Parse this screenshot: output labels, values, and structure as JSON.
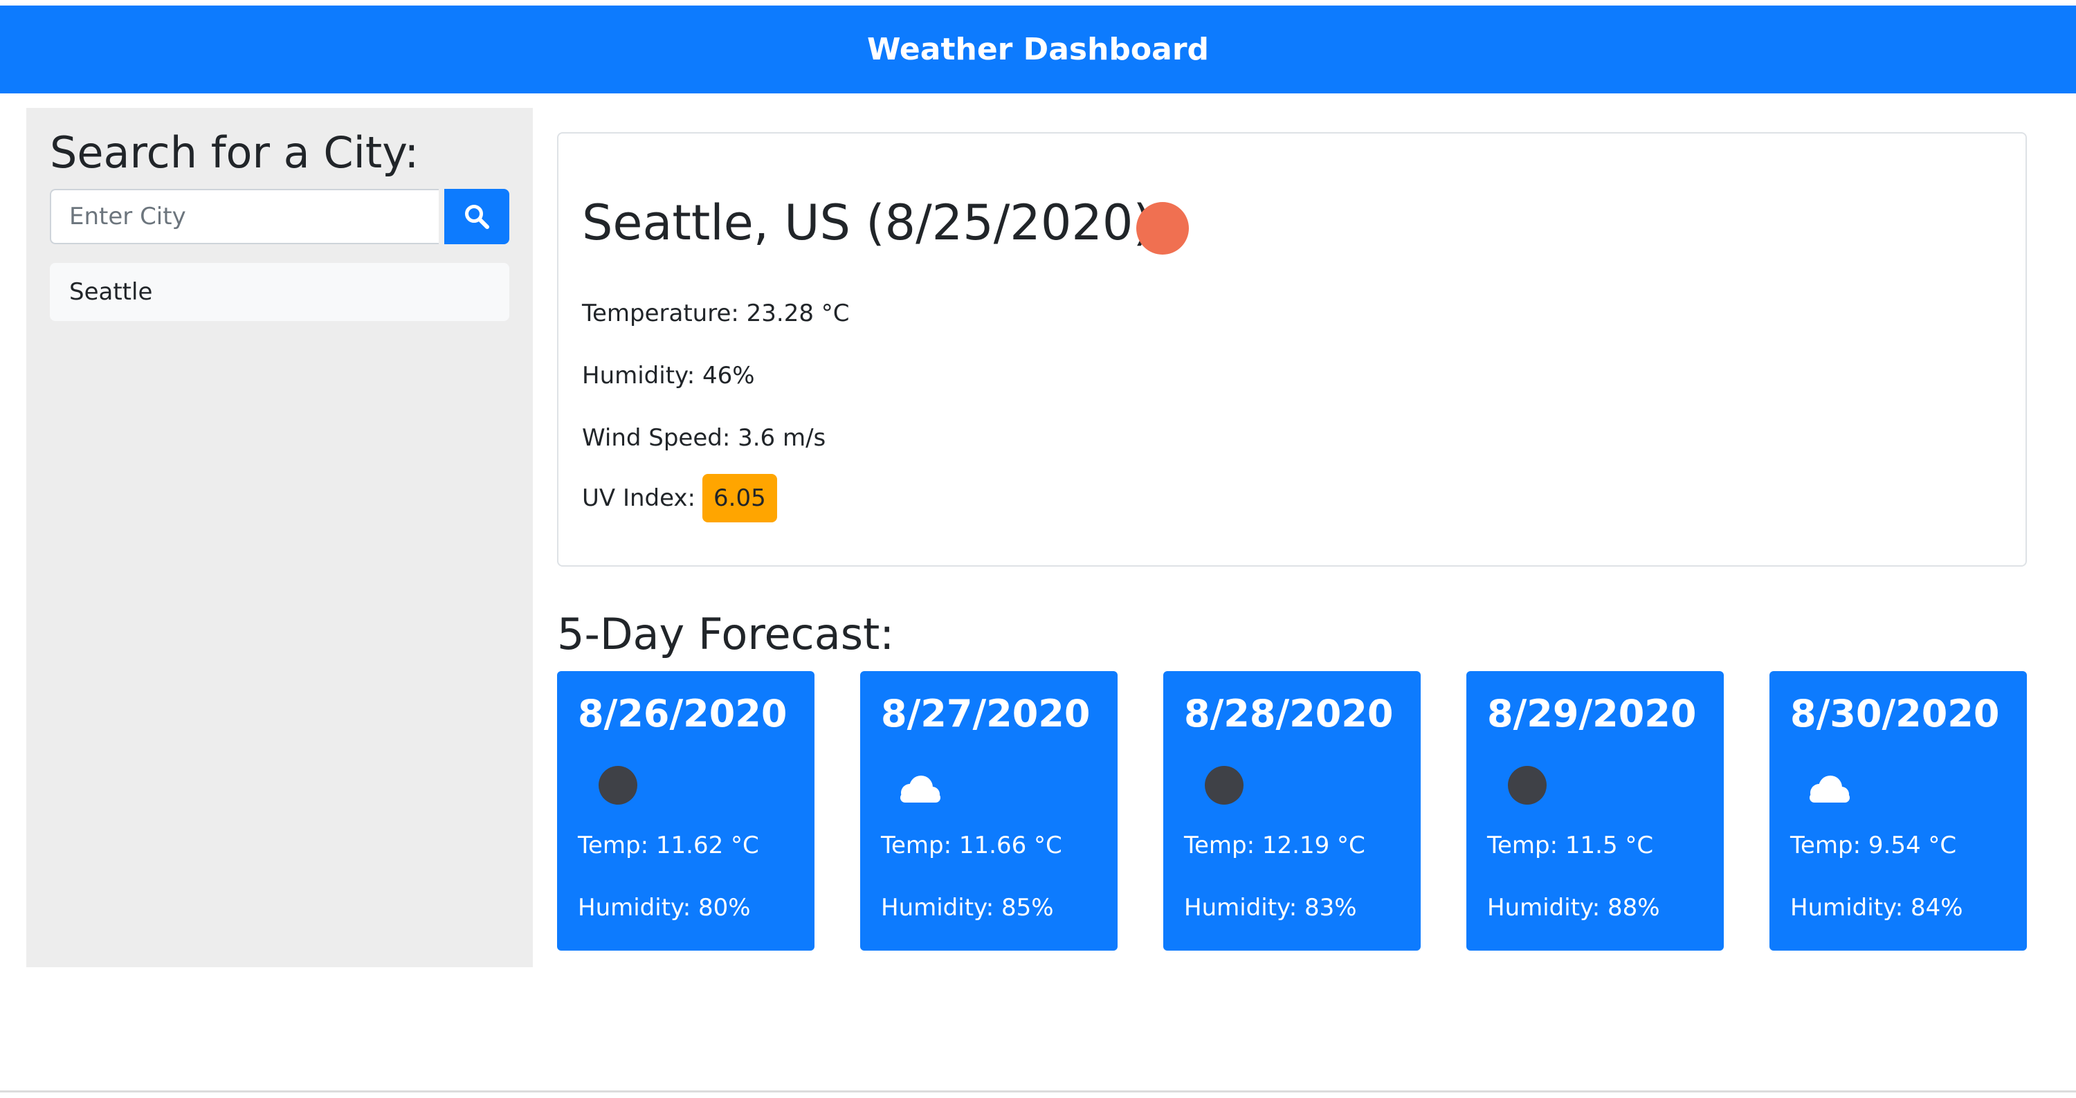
{
  "header": {
    "title": "Weather Dashboard"
  },
  "sidebar": {
    "heading": "Search for a City:",
    "search": {
      "placeholder": "Enter City",
      "value": "",
      "button_icon": "search-icon"
    },
    "history": [
      "Seattle"
    ]
  },
  "current": {
    "heading": "Seattle, US (8/25/2020)",
    "icon": "sun-icon",
    "temperature_text": "Temperature: 23.28 °C",
    "humidity_text": "Humidity: 46%",
    "wind_text": "Wind Speed: 3.6 m/s",
    "uv_label": "UV Index:",
    "uv_value": "6.05",
    "uv_color": "#ffa500"
  },
  "forecast": {
    "heading": "5-Day Forecast:",
    "days": [
      {
        "date": "8/26/2020",
        "icon": "dark-circle-icon",
        "temp": "Temp: 11.62 °C",
        "humidity": "Humidity: 80%"
      },
      {
        "date": "8/27/2020",
        "icon": "cloud-icon",
        "temp": "Temp: 11.66 °C",
        "humidity": "Humidity: 85%"
      },
      {
        "date": "8/28/2020",
        "icon": "dark-circle-icon",
        "temp": "Temp: 12.19 °C",
        "humidity": "Humidity: 83%"
      },
      {
        "date": "8/29/2020",
        "icon": "dark-circle-icon",
        "temp": "Temp: 11.5 °C",
        "humidity": "Humidity: 88%"
      },
      {
        "date": "8/30/2020",
        "icon": "cloud-icon",
        "temp": "Temp: 9.54 °C",
        "humidity": "Humidity: 84%"
      }
    ]
  },
  "colors": {
    "primary": "#0d7bfe",
    "sidebar_bg": "#ededed",
    "sun": "#f07051",
    "dark_icon": "#3f4147",
    "uv_moderate": "#ffa500"
  }
}
